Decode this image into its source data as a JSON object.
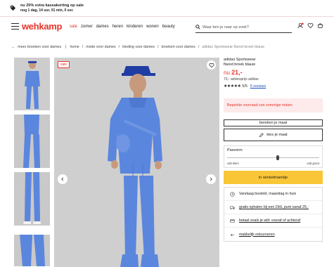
{
  "promo": {
    "line1": "nu 20% extra kassakorting op sale",
    "line2": "nog 1 dag, 14 uur, 01 min, 0 sec"
  },
  "header": {
    "logo": "wehkamp",
    "nav": [
      "sale",
      "zomer",
      "dames",
      "heren",
      "kinderen",
      "wonen",
      "beauty"
    ],
    "search_placeholder": "Waar ben je naar op zoek?"
  },
  "breadcrumb": {
    "back": "meer broeken voor dames",
    "items": [
      "home",
      "mode voor dames",
      "kleding voor dames",
      "broeken voor dames"
    ],
    "current": "adidas Sportswear flared broek blauw"
  },
  "product": {
    "sale_badge": "sale",
    "brand": "adidas Sportswear",
    "name": "flared broek blauw",
    "price_prefix": "nu",
    "price": "21,-",
    "old_price": "70,-  adviesprijs adidas",
    "stars": "★★★★★",
    "rating": "5/5",
    "reviews": "5 reviews",
    "limited_notice": "Beperkte voorraad van sommige maten",
    "size_calc": "bereken je maat",
    "choose_size": "kies je maat",
    "fit_title": "Pasvorm",
    "fit_small": "valt klein",
    "fit_large": "valt groot",
    "fit_level": 0.55,
    "add_to_cart": "in winkelmandje"
  },
  "usps": [
    {
      "icon": "clock-icon",
      "text": "Vandaag besteld, maandag in huis",
      "link": false
    },
    {
      "icon": "truck-icon",
      "text": "gratis ophalen bij een DHL punt vanaf 25,-",
      "link": true
    },
    {
      "icon": "card-icon",
      "text": "betaal zoals je wilt: vooraf of achteraf",
      "link": true
    },
    {
      "icon": "return-icon",
      "text": "makkelijk retourneren",
      "link": true
    }
  ],
  "colors": {
    "brand": "#e8342b",
    "cta": "#f9c638",
    "link": "#1a4fbf",
    "product": "#5b86de"
  }
}
